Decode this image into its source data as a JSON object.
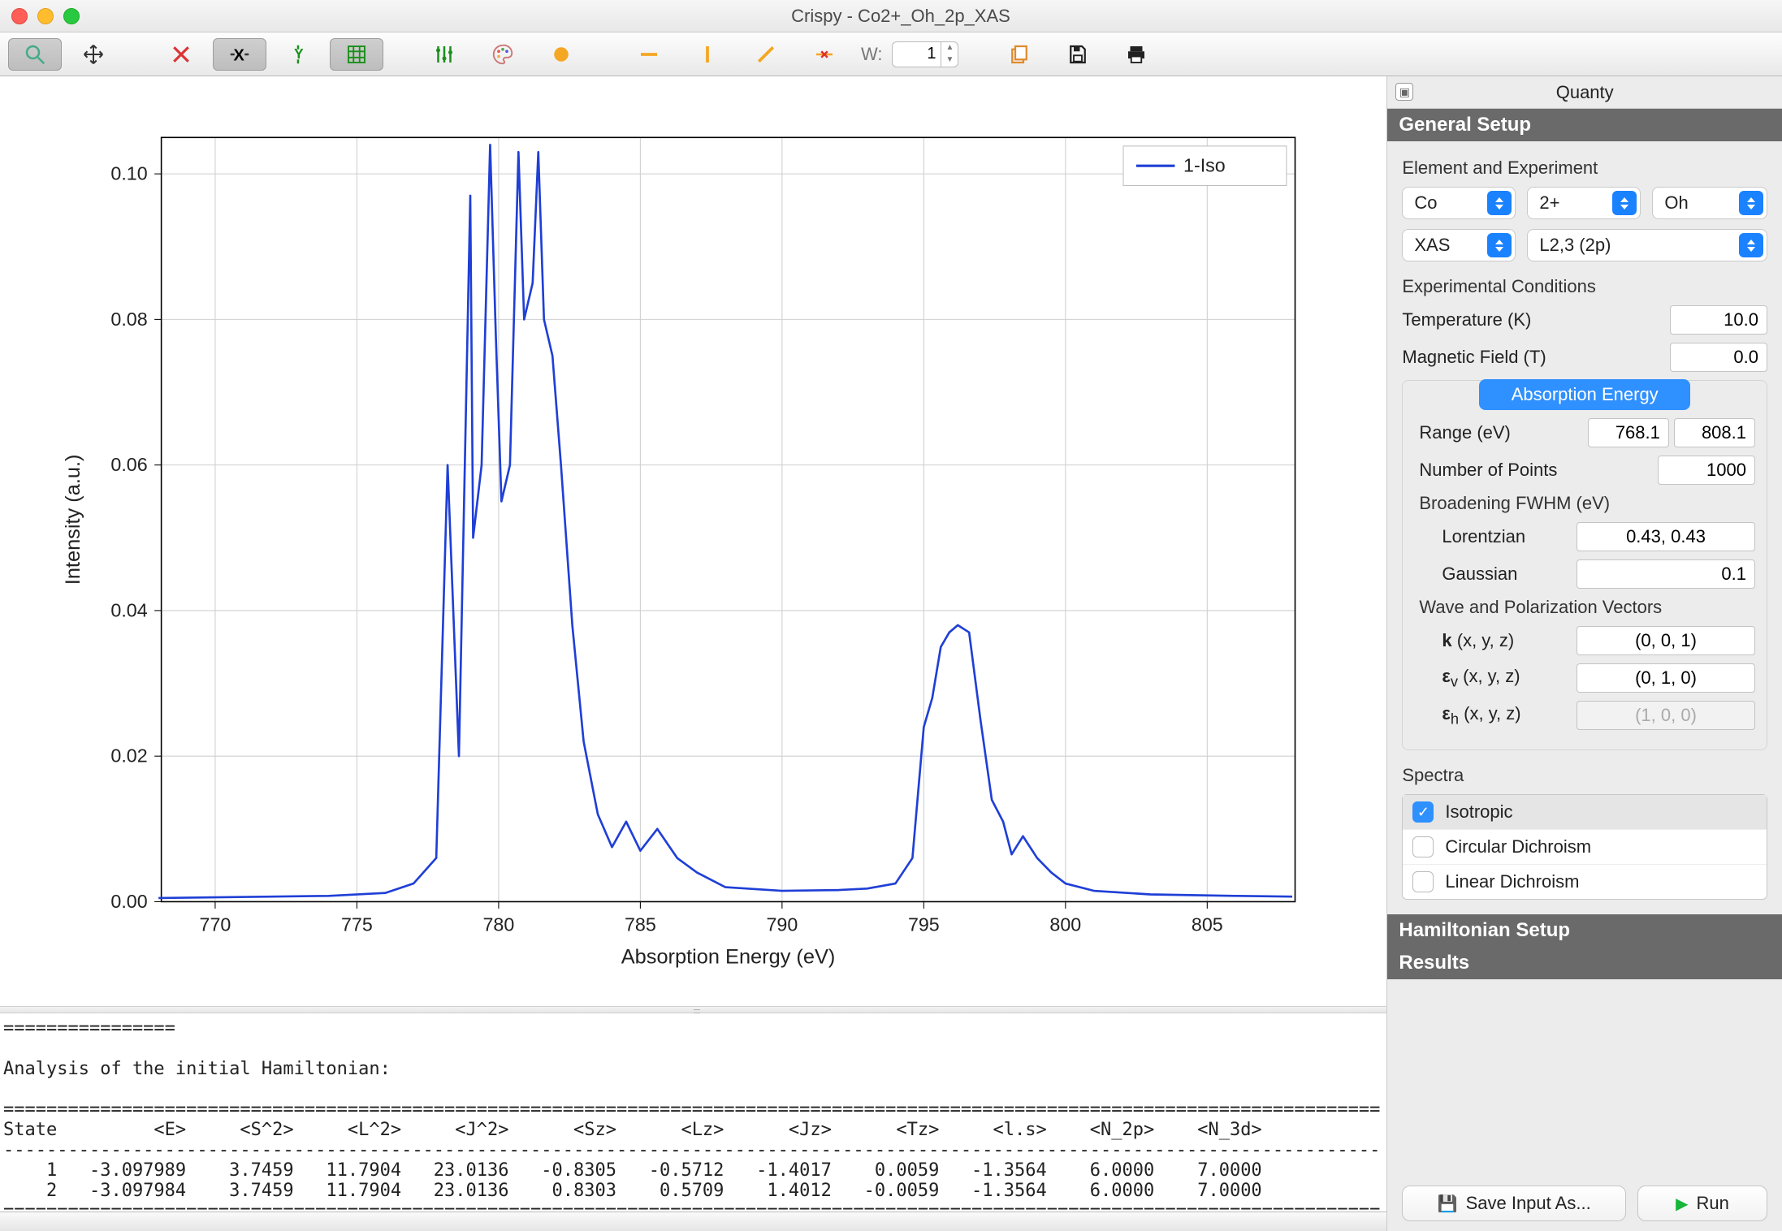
{
  "window_title": "Crispy - Co2+_Oh_2p_XAS",
  "toolbar": {
    "w_label": "W:",
    "w_value": "1"
  },
  "right_panel": {
    "tab_title": "Quanty",
    "general_setup": "General Setup",
    "hamiltonian_setup": "Hamiltonian Setup",
    "results": "Results",
    "element_experiment": "Element and Experiment",
    "selects": {
      "element": "Co",
      "charge": "2+",
      "symmetry": "Oh",
      "technique": "XAS",
      "edge": "L2,3 (2p)"
    },
    "experimental_conditions": "Experimental Conditions",
    "temperature_label": "Temperature (K)",
    "temperature": "10.0",
    "magfield_label": "Magnetic Field (T)",
    "magfield": "0.0",
    "absorption_energy": "Absorption Energy",
    "range_label": "Range (eV)",
    "range_min": "768.1",
    "range_max": "808.1",
    "npoints_label": "Number of Points",
    "npoints": "1000",
    "broadening_label": "Broadening FWHM (eV)",
    "lorentzian_label": "Lorentzian",
    "lorentzian": "0.43, 0.43",
    "gaussian_label": "Gaussian",
    "gaussian": "0.1",
    "wavepol_label": "Wave and Polarization Vectors",
    "k_label": "k (x, y, z)",
    "k": "(0, 0, 1)",
    "ev_label": "εᵥ (x, y, z)",
    "ev": "(0, 1, 0)",
    "eh_label": "εₕ (x, y, z)",
    "eh": "(1, 0, 0)",
    "spectra_label": "Spectra",
    "spectra": [
      "Isotropic",
      "Circular Dichroism",
      "Linear Dichroism"
    ],
    "save_btn": "Save Input As...",
    "run_btn": "Run"
  },
  "chart_data": {
    "type": "line",
    "title": "",
    "xlabel": "Absorption Energy (eV)",
    "ylabel": "Intensity (a.u.)",
    "xlim": [
      768.1,
      808.1
    ],
    "ylim": [
      0.0,
      0.105
    ],
    "yticks": [
      0.0,
      0.02,
      0.04,
      0.06,
      0.08,
      0.1
    ],
    "xticks": [
      770,
      775,
      780,
      785,
      790,
      795,
      800,
      805
    ],
    "legend": [
      "1-Iso"
    ],
    "series": [
      {
        "name": "1-Iso",
        "x": [
          768,
          770,
          772,
          774,
          776,
          777,
          777.8,
          778.2,
          778.6,
          779.0,
          779.1,
          779.4,
          779.7,
          779.9,
          780.1,
          780.4,
          780.7,
          780.9,
          781.2,
          781.4,
          781.6,
          781.9,
          782.2,
          782.6,
          783.0,
          783.5,
          784.0,
          784.5,
          785.0,
          785.6,
          786.3,
          787.0,
          788.0,
          790.0,
          792.0,
          793.0,
          794.0,
          794.6,
          795.0,
          795.3,
          795.6,
          795.9,
          796.2,
          796.6,
          797.0,
          797.4,
          797.8,
          798.1,
          798.5,
          799.0,
          799.5,
          800.0,
          801.0,
          803.0,
          806.0,
          808
        ],
        "y": [
          0.0005,
          0.0006,
          0.0007,
          0.0008,
          0.0012,
          0.0025,
          0.006,
          0.06,
          0.02,
          0.097,
          0.05,
          0.06,
          0.104,
          0.078,
          0.055,
          0.06,
          0.103,
          0.08,
          0.085,
          0.103,
          0.08,
          0.075,
          0.06,
          0.038,
          0.022,
          0.012,
          0.0075,
          0.011,
          0.007,
          0.01,
          0.006,
          0.004,
          0.002,
          0.0015,
          0.0016,
          0.0018,
          0.0025,
          0.006,
          0.024,
          0.028,
          0.035,
          0.037,
          0.038,
          0.037,
          0.025,
          0.014,
          0.011,
          0.0065,
          0.009,
          0.006,
          0.004,
          0.0025,
          0.0015,
          0.001,
          0.0008,
          0.0007
        ]
      }
    ]
  },
  "console": {
    "sep": "================",
    "longline": "================================================================================================================================",
    "dashline": "--------------------------------------------------------------------------------------------------------------------------------",
    "heading": "Analysis of the initial Hamiltonian:",
    "cols": [
      "State",
      "<E>",
      "<S^2>",
      "<L^2>",
      "<J^2>",
      "<Sz>",
      "<Lz>",
      "<Jz>",
      "<Tz>",
      "<l.s>",
      "<N_2p>",
      "<N_3d>"
    ],
    "rows": [
      [
        "1",
        "-3.097989",
        "3.7459",
        "11.7904",
        "23.0136",
        "-0.8305",
        "-0.5712",
        "-1.4017",
        "0.0059",
        "-1.3564",
        "6.0000",
        "7.0000"
      ],
      [
        "2",
        "-3.097984",
        "3.7459",
        "11.7904",
        "23.0136",
        "0.8303",
        "0.5709",
        "1.4012",
        "-0.0059",
        "-1.3564",
        "6.0000",
        "7.0000"
      ]
    ]
  }
}
